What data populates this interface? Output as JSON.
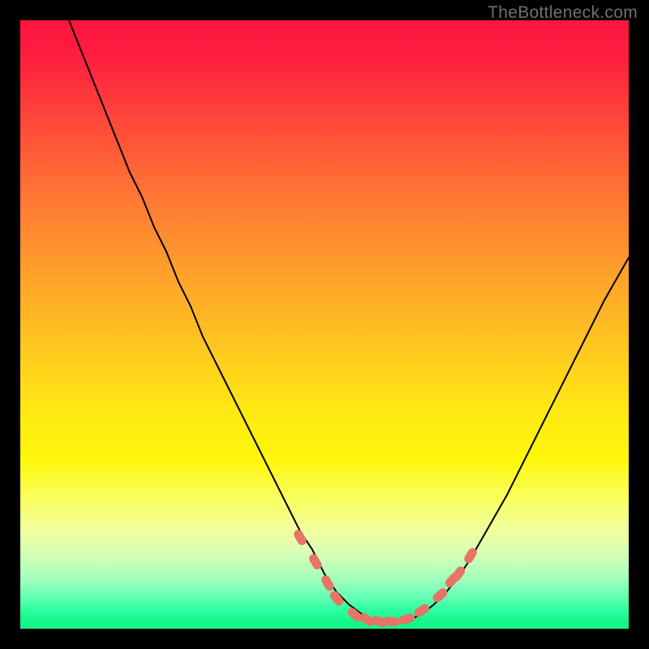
{
  "watermark": "TheBottleneck.com",
  "colors": {
    "frame": "#000000",
    "curve": "#000000",
    "marker": "#e77466",
    "gradient_top": "#ff153f",
    "gradient_bottom": "#15f58a"
  },
  "chart_data": {
    "type": "line",
    "title": "",
    "xlabel": "",
    "ylabel": "",
    "xlim": [
      0,
      100
    ],
    "ylim": [
      0,
      100
    ],
    "note": "No axes, ticks, or labels are rendered; background is a vertical red→yellow→green gradient with a black frame. Y is bottleneck severity (0=green/best, 100=red/worst).",
    "series": [
      {
        "name": "bottleneck-curve",
        "x": [
          8,
          10,
          12,
          14,
          16,
          18,
          20,
          22,
          24,
          26,
          28,
          30,
          32,
          34,
          36,
          38,
          40,
          42,
          44,
          46,
          48,
          50,
          52,
          54,
          56,
          58,
          60,
          62,
          64,
          66,
          68,
          70,
          72,
          74,
          76,
          78,
          80,
          82,
          84,
          86,
          88,
          90,
          92,
          94,
          96,
          98,
          100
        ],
        "y": [
          100,
          95,
          90,
          85,
          80,
          75,
          71,
          66,
          62,
          57,
          53,
          48,
          44,
          40,
          36,
          32,
          28,
          24,
          20,
          16,
          13,
          9,
          6,
          4,
          2.5,
          1.5,
          1.2,
          1.2,
          1.5,
          2.4,
          4,
          6,
          8.5,
          11.5,
          15,
          18.5,
          22,
          26,
          30,
          34,
          38,
          42,
          46,
          50,
          54,
          57.5,
          61
        ]
      }
    ],
    "markers": [
      {
        "x": 46,
        "y": 15
      },
      {
        "x": 48.5,
        "y": 11
      },
      {
        "x": 50.5,
        "y": 7.5
      },
      {
        "x": 52,
        "y": 5
      },
      {
        "x": 55,
        "y": 2.3
      },
      {
        "x": 57,
        "y": 1.5
      },
      {
        "x": 59,
        "y": 1.2
      },
      {
        "x": 61,
        "y": 1.2
      },
      {
        "x": 63.5,
        "y": 1.6
      },
      {
        "x": 66,
        "y": 3
      },
      {
        "x": 69,
        "y": 5.5
      },
      {
        "x": 71,
        "y": 8
      },
      {
        "x": 72,
        "y": 9
      },
      {
        "x": 74,
        "y": 12
      }
    ]
  }
}
